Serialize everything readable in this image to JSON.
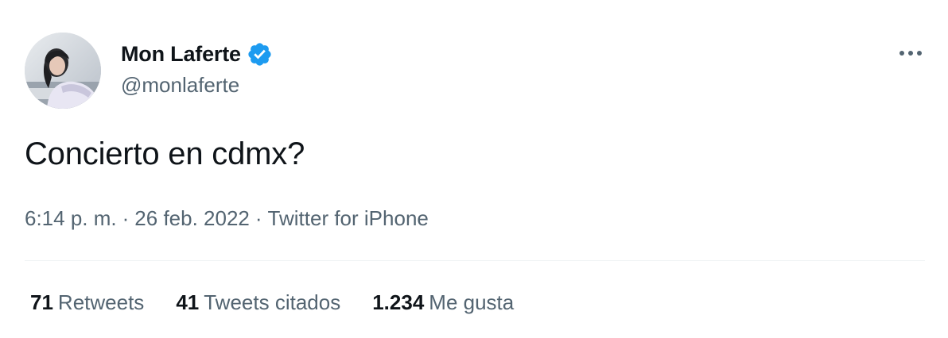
{
  "user": {
    "display_name": "Mon Laferte",
    "handle": "@monlaferte",
    "verified": true
  },
  "tweet": {
    "text": "Concierto en cdmx?"
  },
  "meta": {
    "time": "6:14 p. m.",
    "separator": "·",
    "date": "26 feb. 2022",
    "source": "Twitter for iPhone"
  },
  "stats": {
    "retweets_count": "71",
    "retweets_label": "Retweets",
    "quotes_count": "41",
    "quotes_label": "Tweets citados",
    "likes_count": "1.234",
    "likes_label": "Me gusta"
  },
  "icons": {
    "verified": "verified-badge-icon",
    "more": "more-options-icon"
  },
  "colors": {
    "text_primary": "#0f1419",
    "text_secondary": "#536471",
    "verified_blue": "#1d9bf0",
    "divider": "#eff3f4"
  }
}
